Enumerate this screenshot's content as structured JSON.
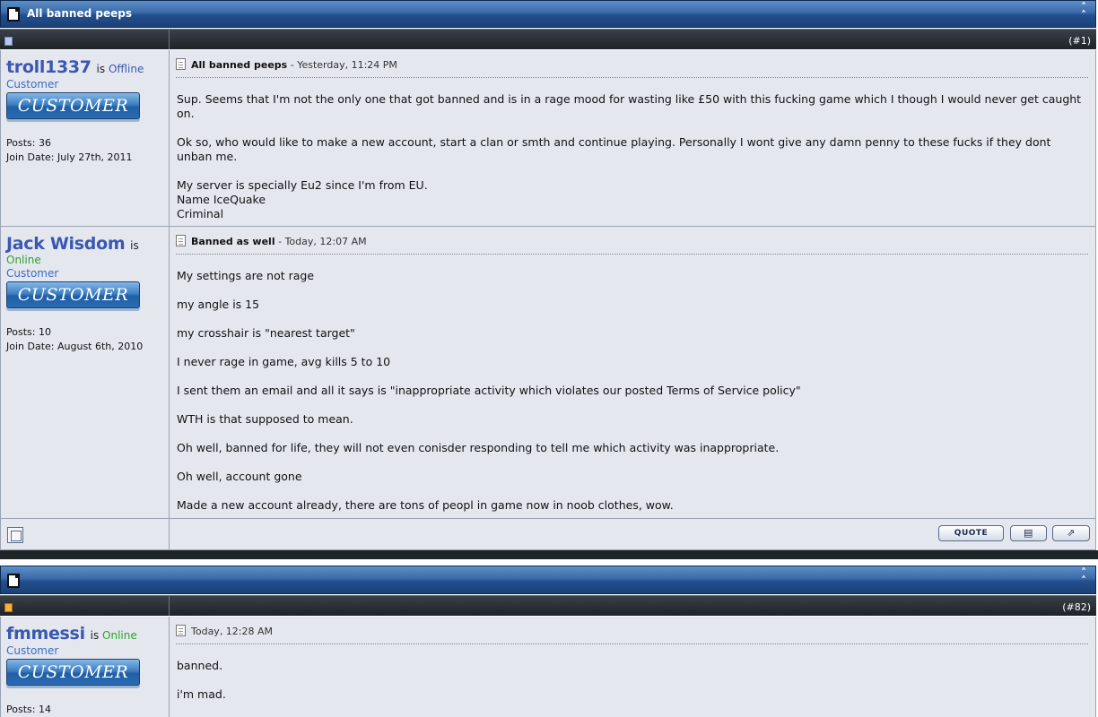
{
  "thread": {
    "title": "All banned peeps",
    "collapse_icon": "collapse-icon"
  },
  "posts": [
    {
      "number": "(#1)",
      "username": "troll1337",
      "is_label": "is",
      "status": "Offline",
      "user_title": "Customer",
      "rank_badge": "CUSTOMER",
      "posts_count": "Posts: 36",
      "join_date": "Join Date: July 27th, 2011",
      "title": "All banned peeps",
      "date": " - Yesterday, 11:24 PM",
      "paragraphs": [
        "Sup. Seems that I'm not the only one that got banned and is in a rage mood for wasting like £50 with this fucking game which I though I would never get caught on.",
        "Ok so, who would like to make a new account, start a clan or smth and continue playing. Personally I wont give any damn penny to these fucks if they dont unban me.",
        "My server is specially Eu2 since I'm from EU.",
        "Name IceQuake",
        "Criminal"
      ]
    },
    {
      "username": "Jack Wisdom",
      "is_label": "is",
      "status": "Online",
      "user_title": "Customer",
      "rank_badge": "CUSTOMER",
      "posts_count": "Posts: 10",
      "join_date": "Join Date: August 6th, 2010",
      "title": "Banned as well",
      "date": " - Today, 12:07 AM",
      "paragraphs": [
        "My settings are not rage",
        "my angle is 15",
        "my crosshair is \"nearest target\"",
        "I never rage in game, avg kills 5 to 10",
        "I sent them an email and all it says is \"inappropriate activity which violates our posted Terms of Service policy\"",
        "WTH is that supposed to mean.",
        "Oh well, banned for life, they will not even conisder responding to tell me which activity was inappropriate.",
        "Oh well, account gone",
        "Made a new account already, there are tons of peopl in game now in noob clothes, wow."
      ],
      "buttons": {
        "quote": "QUOTE",
        "multi_quote_icon": "multi-quote-icon",
        "quick_reply_icon": "quick-reply-icon"
      }
    },
    {
      "number": "(#82)",
      "username": "fmmessi",
      "is_label": "is",
      "status": "Online",
      "user_title": "Customer",
      "rank_badge": "CUSTOMER",
      "posts_count": "Posts: 14",
      "date": "Today, 12:28 AM",
      "paragraphs": [
        "banned.",
        "i'm mad."
      ]
    }
  ],
  "colors": {
    "header_blue": "#234f8e",
    "username_blue": "#3a58b0",
    "online_green": "#2ea12e",
    "post_bg": "#e4e7ee"
  }
}
